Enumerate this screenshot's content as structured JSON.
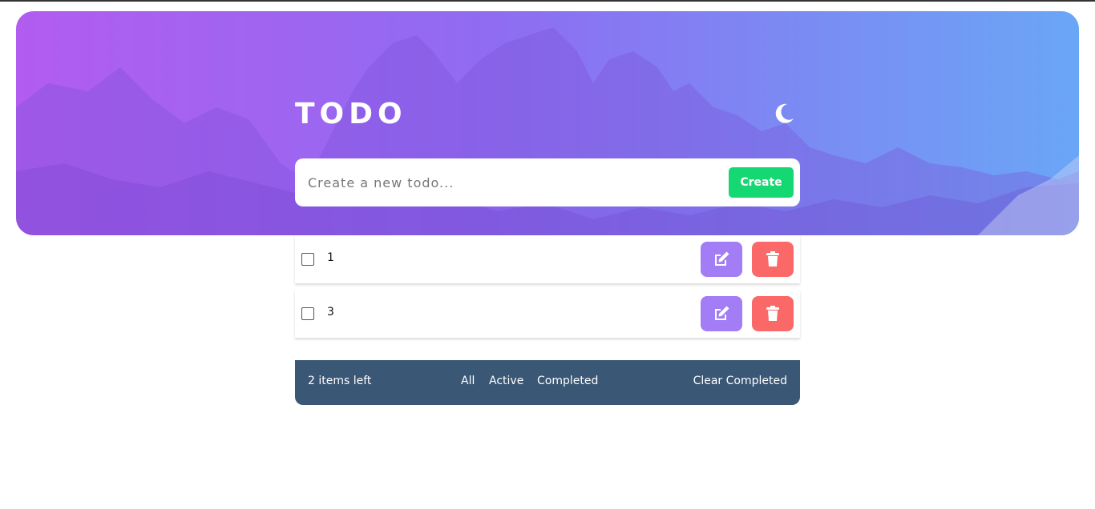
{
  "header": {
    "title": "TODO",
    "theme_icon": "moon-icon"
  },
  "create": {
    "placeholder": "Create a new todo...",
    "button_label": "Create"
  },
  "todos": [
    {
      "text": "1",
      "checked": false
    },
    {
      "text": "3",
      "checked": false
    }
  ],
  "icons": {
    "edit": "edit-icon",
    "delete": "trash-icon"
  },
  "footer": {
    "items_left": "2 items left",
    "filters": [
      "All",
      "Active",
      "Completed"
    ],
    "clear_label": "Clear Completed"
  },
  "colors": {
    "create_button": "#16d873",
    "edit_button": "#a27df5",
    "delete_button": "#fb6868",
    "footer_bg": "#3a5775"
  }
}
